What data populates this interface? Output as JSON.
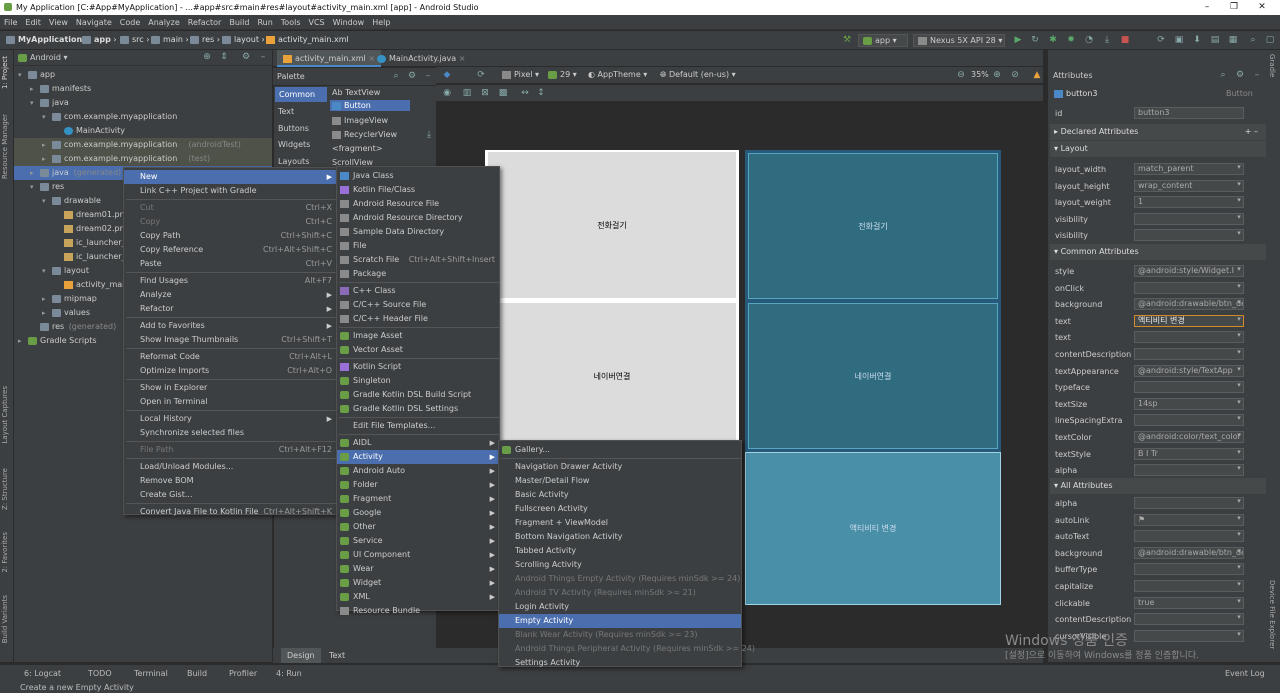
{
  "title_bar": {
    "title": "My Application [C:#App#MyApplication] - ...#app#src#main#res#layout#activity_main.xml [app] - Android Studio",
    "min": "–",
    "max": "❐",
    "close": "✕"
  },
  "menubar": [
    "File",
    "Edit",
    "View",
    "Navigate",
    "Code",
    "Analyze",
    "Refactor",
    "Build",
    "Run",
    "Tools",
    "VCS",
    "Window",
    "Help"
  ],
  "breadcrumb": [
    "MyApplication",
    "app",
    "src",
    "main",
    "res",
    "layout",
    "activity_main.xml"
  ],
  "toolbar": {
    "run_config": "app",
    "device": "Nexus 5X API 28"
  },
  "left_strip": [
    "1: Project",
    "Resource Manager",
    "Layout Captures",
    "Z: Structure",
    "2: Favorites",
    "Build Variants"
  ],
  "project": {
    "view": "Android",
    "tree": [
      {
        "label": "app",
        "indent": 0,
        "icon": "folder",
        "open": true
      },
      {
        "label": "manifests",
        "indent": 1,
        "icon": "folder",
        "open": false
      },
      {
        "label": "java",
        "indent": 1,
        "icon": "folder",
        "open": true
      },
      {
        "label": "com.example.myapplication",
        "indent": 2,
        "icon": "folder",
        "open": true
      },
      {
        "label": "MainActivity",
        "indent": 3,
        "icon": "class"
      },
      {
        "label": "com.example.myapplication",
        "suffix": "(androidTest)",
        "indent": 2,
        "icon": "folder",
        "open": false,
        "hl": true
      },
      {
        "label": "com.example.myapplication",
        "suffix": "(test)",
        "indent": 2,
        "icon": "folder",
        "open": false,
        "hl": true
      },
      {
        "label": "java",
        "suffix": "(generated)",
        "indent": 1,
        "icon": "folder",
        "open": false,
        "sel": true
      },
      {
        "label": "res",
        "indent": 1,
        "icon": "folder",
        "open": true
      },
      {
        "label": "drawable",
        "indent": 2,
        "icon": "folder",
        "open": true
      },
      {
        "label": "dream01.png",
        "indent": 3,
        "icon": "file"
      },
      {
        "label": "dream02.png",
        "indent": 3,
        "icon": "file"
      },
      {
        "label": "ic_launcher_b",
        "indent": 3,
        "icon": "file"
      },
      {
        "label": "ic_launcher_f",
        "indent": 3,
        "icon": "file"
      },
      {
        "label": "layout",
        "indent": 2,
        "icon": "folder",
        "open": true
      },
      {
        "label": "activity_main",
        "indent": 3,
        "icon": "xml"
      },
      {
        "label": "mipmap",
        "indent": 2,
        "icon": "folder",
        "open": false
      },
      {
        "label": "values",
        "indent": 2,
        "icon": "folder",
        "open": false
      },
      {
        "label": "res",
        "suffix": "(generated)",
        "indent": 1,
        "icon": "folder"
      },
      {
        "label": "Gradle Scripts",
        "indent": 0,
        "icon": "gradle",
        "open": false
      }
    ]
  },
  "editor_tabs": [
    "activity_main.xml",
    "MainActivity.java"
  ],
  "palette": {
    "title": "Palette",
    "categories": [
      "Common",
      "Text",
      "Buttons",
      "Widgets",
      "Layouts"
    ],
    "items": [
      "Ab TextView",
      "Button",
      "ImageView",
      "RecyclerView",
      "<fragment>",
      "ScrollView"
    ]
  },
  "design_toolbar": {
    "device": "Pixel",
    "api": "29",
    "theme": "AppTheme",
    "locale": "Default (en-us)",
    "zoom": "35%"
  },
  "canvas": {
    "design_buttons": [
      "전화걸기",
      "네이버연결"
    ],
    "blueprint_buttons": [
      "전화걸기",
      "네이버연결",
      "액티비티 변경"
    ]
  },
  "bottom_tabs": [
    "Design",
    "Text"
  ],
  "attributes": {
    "title": "Attributes",
    "component": "button3",
    "component_type": "Button",
    "id_label": "id",
    "id_value": "button3",
    "sections": [
      "Declared Attributes",
      "Layout",
      "Common Attributes",
      "All Attributes"
    ],
    "layout": [
      [
        "layout_width",
        "match_parent"
      ],
      [
        "layout_height",
        "wrap_content"
      ],
      [
        "layout_weight",
        "1"
      ],
      [
        "visibility",
        ""
      ],
      [
        "visibility",
        ""
      ]
    ],
    "common": [
      [
        "style",
        "@android:style/Widget.I"
      ],
      [
        "onClick",
        ""
      ],
      [
        "background",
        "@android:drawable/btn_de"
      ],
      [
        "text",
        "액티비티 변경"
      ],
      [
        "text",
        ""
      ],
      [
        "contentDescription",
        ""
      ],
      [
        "textAppearance",
        "@android:style/TextApp"
      ],
      [
        "typeface",
        ""
      ],
      [
        "textSize",
        "14sp"
      ],
      [
        "lineSpacingExtra",
        ""
      ],
      [
        "textColor",
        "@android:color/text_color"
      ],
      [
        "textStyle",
        "B  I  Tr"
      ],
      [
        "alpha",
        ""
      ]
    ],
    "all": [
      [
        "alpha",
        ""
      ],
      [
        "autoLink",
        "⚑"
      ],
      [
        "autoText",
        ""
      ],
      [
        "background",
        "@android:drawable/btn_de"
      ],
      [
        "bufferType",
        ""
      ],
      [
        "capitalize",
        ""
      ],
      [
        "clickable",
        "true"
      ],
      [
        "contentDescription",
        ""
      ],
      [
        "cursorVisible",
        ""
      ]
    ]
  },
  "context_menu": [
    {
      "label": "New",
      "sel": true,
      "arrow": true
    },
    {
      "label": "Link C++ Project with Gradle"
    },
    {
      "sep": true
    },
    {
      "label": "Cut",
      "sc": "Ctrl+X",
      "dis": true
    },
    {
      "label": "Copy",
      "sc": "Ctrl+C",
      "dis": true
    },
    {
      "label": "Copy Path",
      "sc": "Ctrl+Shift+C"
    },
    {
      "label": "Copy Reference",
      "sc": "Ctrl+Alt+Shift+C"
    },
    {
      "label": "Paste",
      "sc": "Ctrl+V"
    },
    {
      "sep": true
    },
    {
      "label": "Find Usages",
      "sc": "Alt+F7"
    },
    {
      "label": "Analyze",
      "arrow": true
    },
    {
      "label": "Refactor",
      "arrow": true
    },
    {
      "sep": true
    },
    {
      "label": "Add to Favorites",
      "arrow": true
    },
    {
      "label": "Show Image Thumbnails",
      "sc": "Ctrl+Shift+T"
    },
    {
      "sep": true
    },
    {
      "label": "Reformat Code",
      "sc": "Ctrl+Alt+L"
    },
    {
      "label": "Optimize Imports",
      "sc": "Ctrl+Alt+O"
    },
    {
      "sep": true
    },
    {
      "label": "Show in Explorer"
    },
    {
      "label": "Open in Terminal"
    },
    {
      "sep": true
    },
    {
      "label": "Local History",
      "arrow": true
    },
    {
      "label": "Synchronize selected files"
    },
    {
      "sep": true
    },
    {
      "label": "File Path",
      "sc": "Ctrl+Alt+F12",
      "dis": true
    },
    {
      "sep": true
    },
    {
      "label": "Load/Unload Modules..."
    },
    {
      "label": "Remove BOM"
    },
    {
      "label": "Create Gist..."
    },
    {
      "sep": true
    },
    {
      "label": "Convert Java File to Kotlin File",
      "sc": "Ctrl+Alt+Shift+K"
    }
  ],
  "new_menu": [
    {
      "label": "Java Class",
      "icon": "blue"
    },
    {
      "label": "Kotlin File/Class",
      "icon": "kt"
    },
    {
      "label": "Android Resource File",
      "icon": "grey"
    },
    {
      "label": "Android Resource Directory",
      "icon": "grey"
    },
    {
      "label": "Sample Data Directory",
      "icon": "grey"
    },
    {
      "label": "File",
      "icon": "grey"
    },
    {
      "label": "Scratch File",
      "sc": "Ctrl+Alt+Shift+Insert",
      "icon": "grey"
    },
    {
      "label": "Package",
      "icon": "grey"
    },
    {
      "sep": true
    },
    {
      "label": "C++ Class",
      "icon": "purp"
    },
    {
      "label": "C/C++ Source File",
      "icon": "grey"
    },
    {
      "label": "C/C++ Header File",
      "icon": "grey"
    },
    {
      "sep": true
    },
    {
      "label": "Image Asset",
      "icon": "g"
    },
    {
      "label": "Vector Asset",
      "icon": "g"
    },
    {
      "sep": true
    },
    {
      "label": "Kotlin Script",
      "icon": "kt"
    },
    {
      "label": "Singleton",
      "icon": "g"
    },
    {
      "label": "Gradle Kotlin DSL Build Script",
      "icon": "g"
    },
    {
      "label": "Gradle Kotlin DSL Settings",
      "icon": "g"
    },
    {
      "sep": true
    },
    {
      "label": "Edit File Templates..."
    },
    {
      "sep": true
    },
    {
      "label": "AIDL",
      "arrow": true,
      "icon": "g"
    },
    {
      "label": "Activity",
      "arrow": true,
      "sel": true,
      "icon": "g"
    },
    {
      "label": "Android Auto",
      "arrow": true,
      "icon": "g"
    },
    {
      "label": "Folder",
      "arrow": true,
      "icon": "g"
    },
    {
      "label": "Fragment",
      "arrow": true,
      "icon": "g"
    },
    {
      "label": "Google",
      "arrow": true,
      "icon": "g"
    },
    {
      "label": "Other",
      "arrow": true,
      "icon": "g"
    },
    {
      "label": "Service",
      "arrow": true,
      "icon": "g"
    },
    {
      "label": "UI Component",
      "arrow": true,
      "icon": "g"
    },
    {
      "label": "Wear",
      "arrow": true,
      "icon": "g"
    },
    {
      "label": "Widget",
      "arrow": true,
      "icon": "g"
    },
    {
      "label": "XML",
      "arrow": true,
      "icon": "g"
    },
    {
      "label": "Resource Bundle",
      "icon": "grey"
    }
  ],
  "activity_menu": [
    {
      "label": "Gallery...",
      "icon": "g"
    },
    {
      "sep": true
    },
    {
      "label": "Navigation Drawer Activity"
    },
    {
      "label": "Master/Detail Flow"
    },
    {
      "label": "Basic Activity"
    },
    {
      "label": "Fullscreen Activity"
    },
    {
      "label": "Fragment + ViewModel"
    },
    {
      "label": "Bottom Navigation Activity"
    },
    {
      "label": "Tabbed Activity"
    },
    {
      "label": "Scrolling Activity"
    },
    {
      "label": "Android Things Empty Activity (Requires minSdk >= 24)",
      "dis": true
    },
    {
      "label": "Android TV Activity (Requires minSdk >= 21)",
      "dis": true
    },
    {
      "label": "Login Activity"
    },
    {
      "label": "Empty Activity",
      "sel": true
    },
    {
      "label": "Blank Wear Activity (Requires minSdk >= 23)",
      "dis": true
    },
    {
      "label": "Android Things Peripheral Activity (Requires minSdk >= 24)",
      "dis": true
    },
    {
      "label": "Settings Activity"
    }
  ],
  "watermark": {
    "line1": "Windows 정품 인증",
    "line2": "[설정]으로 이동하여 Windows를 정품 인증합니다."
  },
  "status": {
    "tabs": [
      "6: Logcat",
      "TODO",
      "Terminal",
      "Build",
      "Profiler",
      "4: Run"
    ],
    "event_log": "Event Log",
    "message": "Create a new Empty Activity"
  },
  "right_strip": [
    "Gradle",
    "Device File Explorer"
  ]
}
